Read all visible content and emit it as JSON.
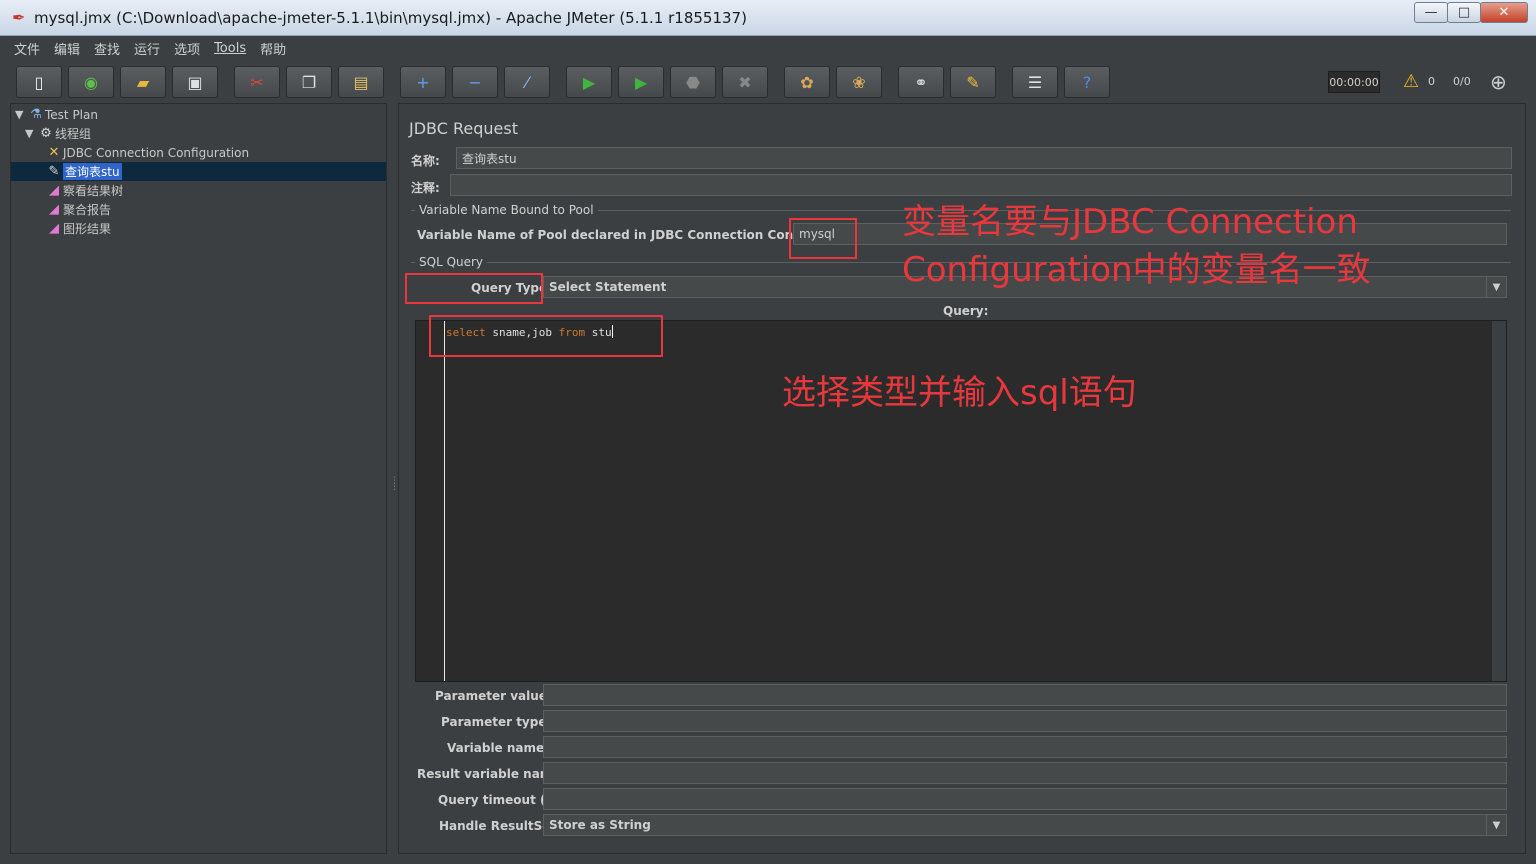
{
  "window": {
    "title": "mysql.jmx (C:\\Download\\apache-jmeter-5.1.1\\bin\\mysql.jmx) - Apache JMeter (5.1.1 r1855137)",
    "controls": {
      "minimize": "—",
      "maximize": "□",
      "close": "✕"
    }
  },
  "menu": [
    "文件",
    "编辑",
    "查找",
    "运行",
    "选项",
    "Tools",
    "帮助"
  ],
  "toolbar": {
    "icons": [
      "new-icon",
      "templates-icon",
      "open-icon",
      "save-icon",
      "cut-icon",
      "copy-icon",
      "paste-icon",
      "expand-icon",
      "collapse-icon",
      "toggle-icon",
      "start-icon",
      "start-no-pause-icon",
      "stop-icon",
      "shutdown-icon",
      "clear-icon",
      "clear-all-icon",
      "search-icon",
      "reset-search-icon",
      "function-helper-icon",
      "help-icon"
    ],
    "timer": "00:00:00",
    "warning_count": "0",
    "threads": "0/0"
  },
  "tree": {
    "test_plan": "Test Plan",
    "thread_group": "线程组",
    "items": [
      "JDBC Connection Configuration",
      "查询表stu",
      "察看结果树",
      "聚合报告",
      "图形结果"
    ]
  },
  "panel": {
    "title": "JDBC Request",
    "name_label": "名称:",
    "name_value": "查询表stu",
    "comment_label": "注释:",
    "comment_value": "",
    "pool_group": "Variable Name Bound to Pool",
    "pool_label": "Variable Name of Pool declared in JDBC Connection Configuration:",
    "pool_value": "mysql",
    "sql_group": "SQL Query",
    "query_type_label": "Query Type:",
    "query_type_value": "Select Statement",
    "query_label": "Query:",
    "code": {
      "kw1": "select",
      "mid": " sname,job ",
      "kw2": "from",
      "tail": " stu"
    },
    "params": [
      {
        "label": "Parameter values:",
        "value": ""
      },
      {
        "label": "Parameter types:",
        "value": ""
      },
      {
        "label": "Variable names:",
        "value": ""
      },
      {
        "label": "Result variable name:",
        "value": ""
      },
      {
        "label": "Query timeout (s):",
        "value": ""
      }
    ],
    "handle_label": "Handle ResultSet:",
    "handle_value": "Store as String"
  },
  "annotations": {
    "note1_line1": "变量名要与JDBC Connection",
    "note1_line2": "Configuration中的变量名一致",
    "note2": "选择类型并输入sql语句",
    "color": "#e8383d"
  }
}
